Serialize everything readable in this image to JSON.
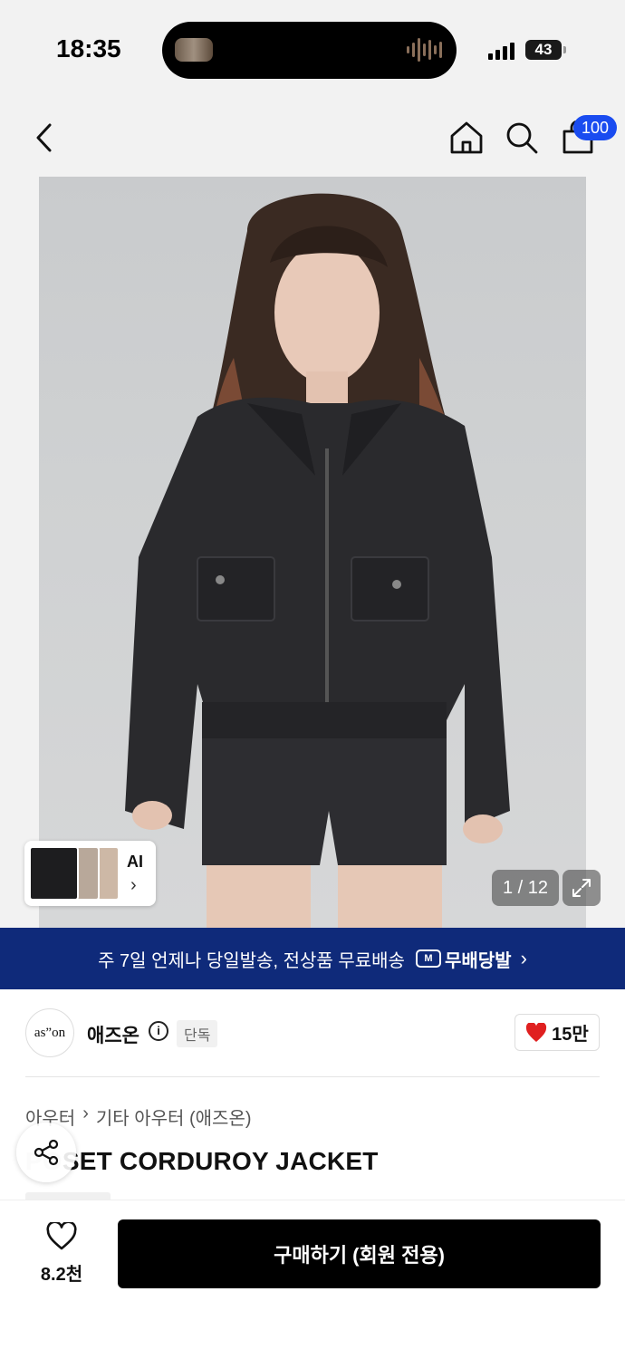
{
  "status_bar": {
    "time": "18:35",
    "battery": "43"
  },
  "header": {
    "cart_badge": "100",
    "icons": [
      "back-chevron",
      "home",
      "search",
      "shopping-bag"
    ]
  },
  "gallery": {
    "counter": "1 / 12",
    "ai_label": "AI",
    "ai_chevron": "›",
    "expand_icon": "expand-arrows"
  },
  "banner": {
    "text": "주 7일 언제나 당일발송, 전상품 무료배송",
    "badge_icon_text": "M",
    "badge_label": "무배당발",
    "chevron": "›"
  },
  "brand": {
    "logo_text": "as”on",
    "name": "애즈온",
    "info_icon": "i",
    "exclusive_label": "단독",
    "likes": "15만",
    "like_color": "#e02020"
  },
  "breadcrumb": {
    "level1": "아우터",
    "separator": "›",
    "level2": "기타 아우터 (애즈온)"
  },
  "product": {
    "title": "POSSET CORDUROY JACKET",
    "visible_title": "SET CORDUROY JACKET"
  },
  "bottom_bar": {
    "wish_count": "8.2천",
    "buy_label": "구매하기 (회원 전용)"
  },
  "colors": {
    "banner_bg": "#0f2a7a",
    "badge_blue": "#1a4cf0",
    "buy_button": "#000000"
  }
}
